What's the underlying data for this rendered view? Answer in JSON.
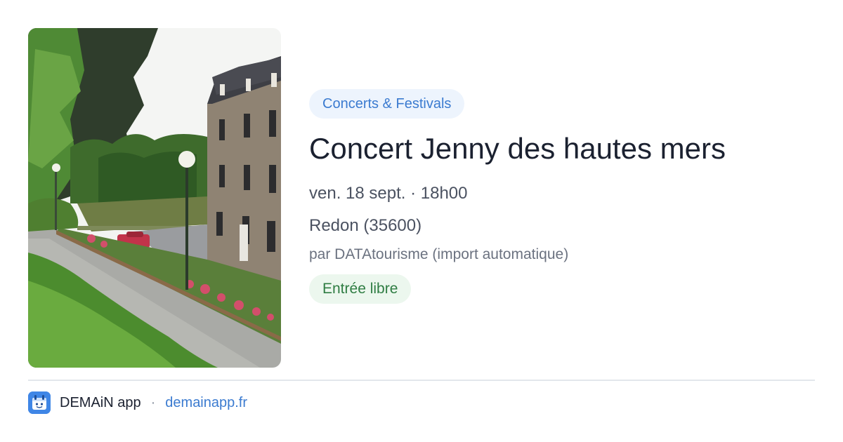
{
  "event": {
    "category": "Concerts & Festivals",
    "title": "Concert Jenny des hautes mers",
    "datetime": "ven. 18 sept. · 18h00",
    "location": "Redon (35600)",
    "organizer": "par DATAtourisme (import automatique)",
    "price": "Entrée libre"
  },
  "footer": {
    "app_name": "DEMAiN app",
    "separator": "·",
    "url": "demainapp.fr"
  },
  "colors": {
    "accent_blue": "#3b7bd0",
    "category_bg": "#edf4fd",
    "price_green": "#2f7d43",
    "price_bg": "#ecf7ee",
    "logo_blue": "#3f86e6"
  },
  "icons": {
    "app_logo": "demain-app-logo-icon"
  }
}
